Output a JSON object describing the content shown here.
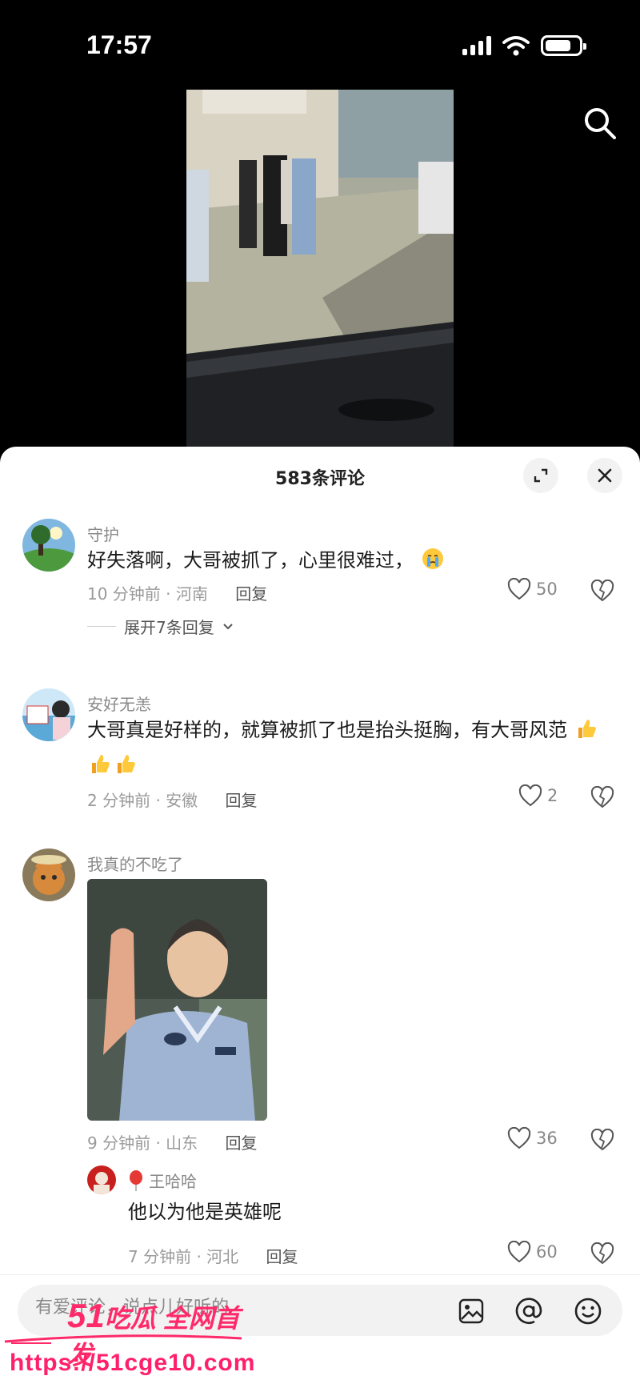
{
  "status_bar": {
    "time": "17:57"
  },
  "comments_panel": {
    "title": "583条评论",
    "comments": [
      {
        "username": "守护",
        "text": "好失落啊，大哥被抓了，心里很难过，",
        "emoji": "crying-emoji",
        "time_location": "10 分钟前 · 河南",
        "reply_label": "回复",
        "likes": "50",
        "expand_replies": "展开7条回复"
      },
      {
        "username": "安好无恙",
        "text": "大哥真是好样的，就算被抓了也是抬头挺胸，有大哥风范",
        "emoji": "thumbs-up-emoji",
        "time_location": "2 分钟前 · 安徽",
        "reply_label": "回复",
        "likes": "2"
      },
      {
        "username": "我真的不吃了",
        "image": "photo-man-in-uniform-waving",
        "time_location": "9 分钟前 · 山东",
        "reply_label": "回复",
        "likes": "36"
      }
    ],
    "sub_reply": {
      "username": "王哈哈",
      "text": "他以为他是英雄呢",
      "time_location": "7 分钟前 · 河北",
      "reply_label": "回复",
      "likes": "60"
    }
  },
  "input_bar": {
    "placeholder": "有爱评论，说点儿好听的"
  },
  "watermark": {
    "brand_number": "51",
    "brand_text": "吃瓜 全网首发",
    "url": "https://51cge10.com"
  },
  "colors": {
    "accent": "#ff2a6a",
    "sheet_bg": "#ffffff",
    "text_primary": "#1a1a1a",
    "text_secondary": "#9a9a9a"
  }
}
